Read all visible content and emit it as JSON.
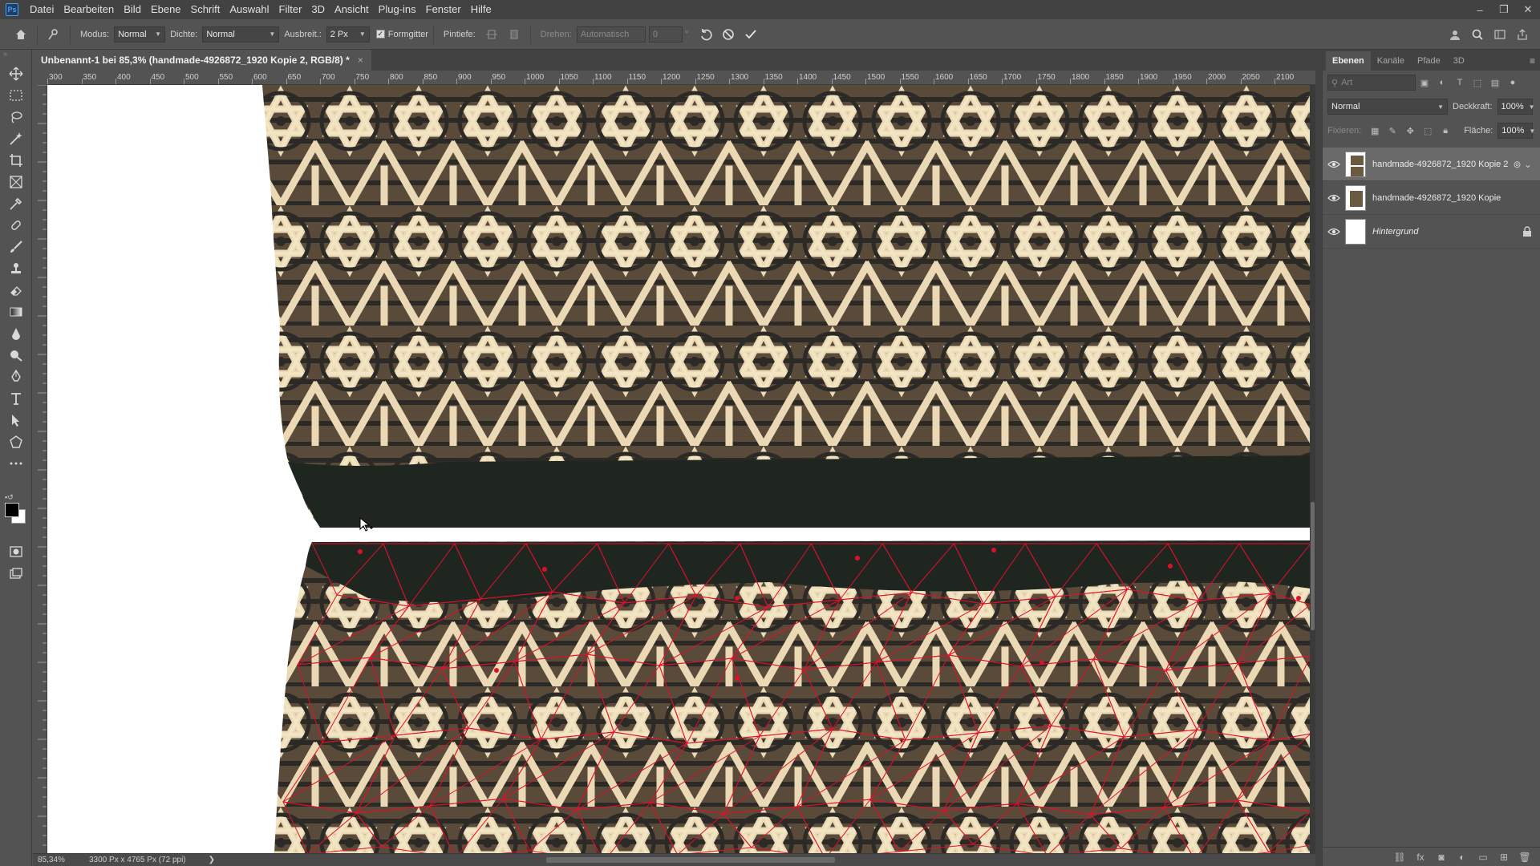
{
  "app": {
    "logo_text": "Ps"
  },
  "menu": [
    "Datei",
    "Bearbeiten",
    "Bild",
    "Ebene",
    "Schrift",
    "Auswahl",
    "Filter",
    "3D",
    "Ansicht",
    "Plug-ins",
    "Fenster",
    "Hilfe"
  ],
  "window_controls": {
    "minimize": "–",
    "restore": "❐",
    "close": "✕"
  },
  "options": {
    "mode_label": "Modus:",
    "mode_value": "Normal",
    "density_label": "Dichte:",
    "density_value": "Normal",
    "spread_label": "Ausbreit.:",
    "spread_value": "2 Px",
    "shape_label": "Formgitter",
    "pin_depth_label": "Pintiefe:",
    "rotate_label": "Drehen:",
    "rotate_value": "Automatisch",
    "angle_value": "0",
    "degree": "°"
  },
  "document": {
    "tab_title": "Unbenannt-1 bei 85,3% (handmade-4926872_1920 Kopie 2, RGB/8) *",
    "tab_close": "×"
  },
  "ruler": {
    "top": [
      "300",
      "350",
      "400",
      "450",
      "500",
      "550",
      "600",
      "650",
      "700",
      "750",
      "800",
      "850",
      "900",
      "950",
      "1000",
      "1050",
      "1100",
      "1150",
      "1200",
      "1250",
      "1300",
      "1350",
      "1400",
      "1450",
      "1500",
      "1550",
      "1600",
      "1650",
      "1700",
      "1750",
      "1800",
      "1850",
      "1900",
      "1950",
      "2000",
      "2050",
      "2100"
    ]
  },
  "status": {
    "zoom": "85,34%",
    "size": "3300 Px x 4765 Px (72 ppi)",
    "arrow": "❯"
  },
  "panel": {
    "tabs": [
      "Ebenen",
      "Kanäle",
      "Pfade",
      "3D"
    ],
    "filter_placeholder": "Art",
    "blend_mode": "Normal",
    "opacity_label": "Deckkraft:",
    "opacity_value": "100%",
    "lock_label": "Fixieren:",
    "fill_label": "Fläche:",
    "fill_value": "100%",
    "layers": [
      {
        "name": "handmade-4926872_1920 Kopie 2",
        "selected": true
      },
      {
        "name": "handmade-4926872_1920 Kopie",
        "selected": false
      },
      {
        "name": "Hintergrund",
        "selected": false
      }
    ]
  },
  "colors": {
    "accent": "#31a8ff",
    "mesh": "#e0102a",
    "fg": "#000000",
    "bg": "#ffffff"
  }
}
